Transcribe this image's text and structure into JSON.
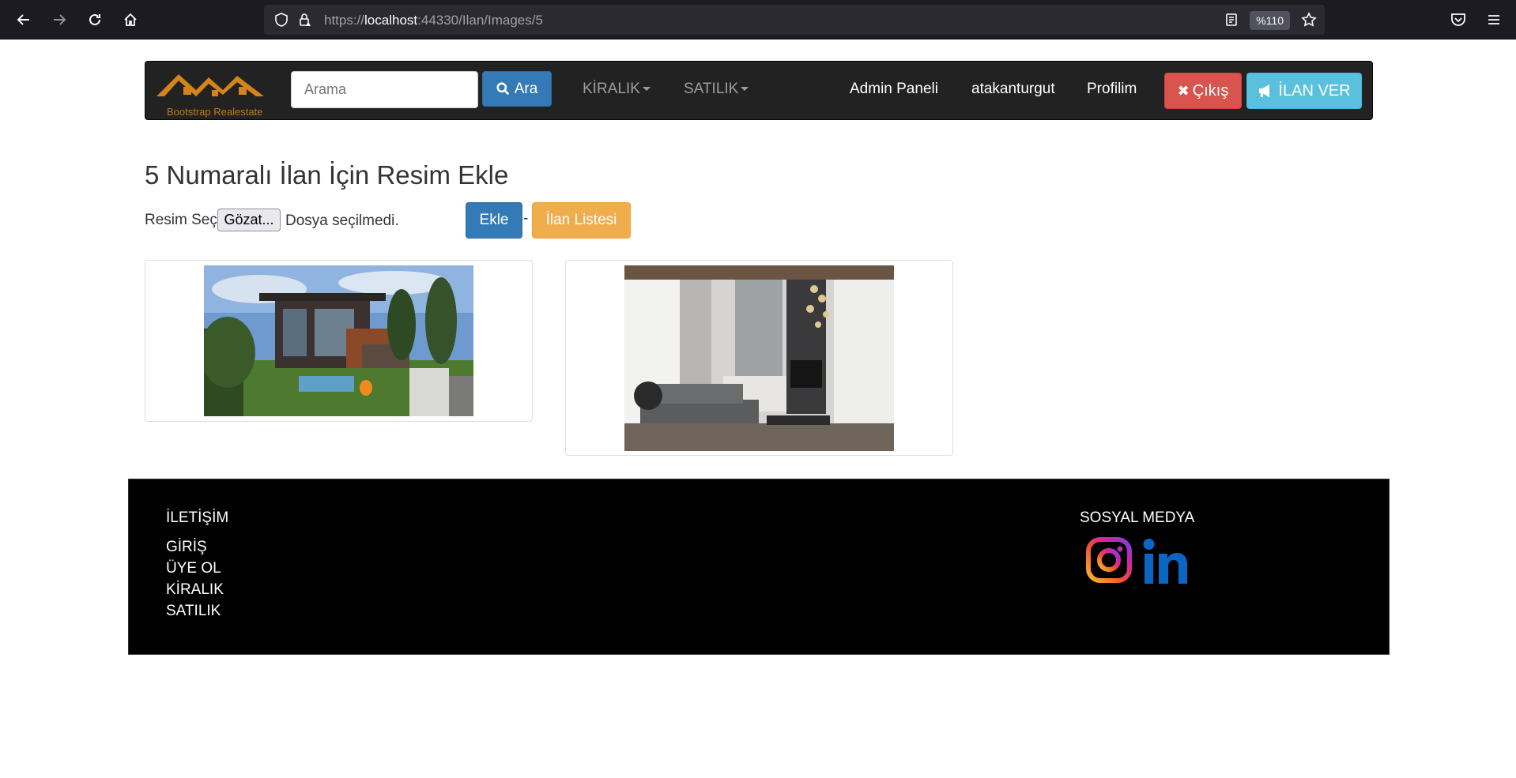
{
  "browser": {
    "url_prefix": "https://",
    "url_host": "localhost",
    "url_rest": ":44330/Ilan/Images/5",
    "zoom": "%110"
  },
  "navbar": {
    "brand": "Bootstrap Realestate",
    "search_placeholder": "Arama",
    "search_button": "Ara",
    "dropdown_kiralik": "KİRALIK",
    "dropdown_satilik": "SATILIK",
    "admin_panel": "Admin Paneli",
    "username": "atakanturgut",
    "profile": "Profilim",
    "logout": "Çıkış",
    "post_ad": "İLAN VER"
  },
  "main": {
    "title": "5 Numaralı İlan İçin Resim Ekle",
    "file_label": "Resim Seç",
    "file_button": "Gözat...",
    "file_status": "Dosya seçilmedi.",
    "add_button": "Ekle",
    "separator": "-",
    "list_button": "İlan Listesi"
  },
  "footer": {
    "contact_heading": "İLETİŞİM",
    "links": [
      "GİRİŞ",
      "ÜYE OL",
      "KİRALIK",
      "SATILIK"
    ],
    "social_heading": "SOSYAL MEDYA",
    "social_icons": [
      "instagram-icon",
      "linkedin-icon"
    ]
  },
  "colors": {
    "primary": "#337ab7",
    "danger": "#d9534f",
    "info": "#5bc0de",
    "warning": "#f0ad4e",
    "navbar": "#222222",
    "linkedin": "#0a66c2"
  }
}
